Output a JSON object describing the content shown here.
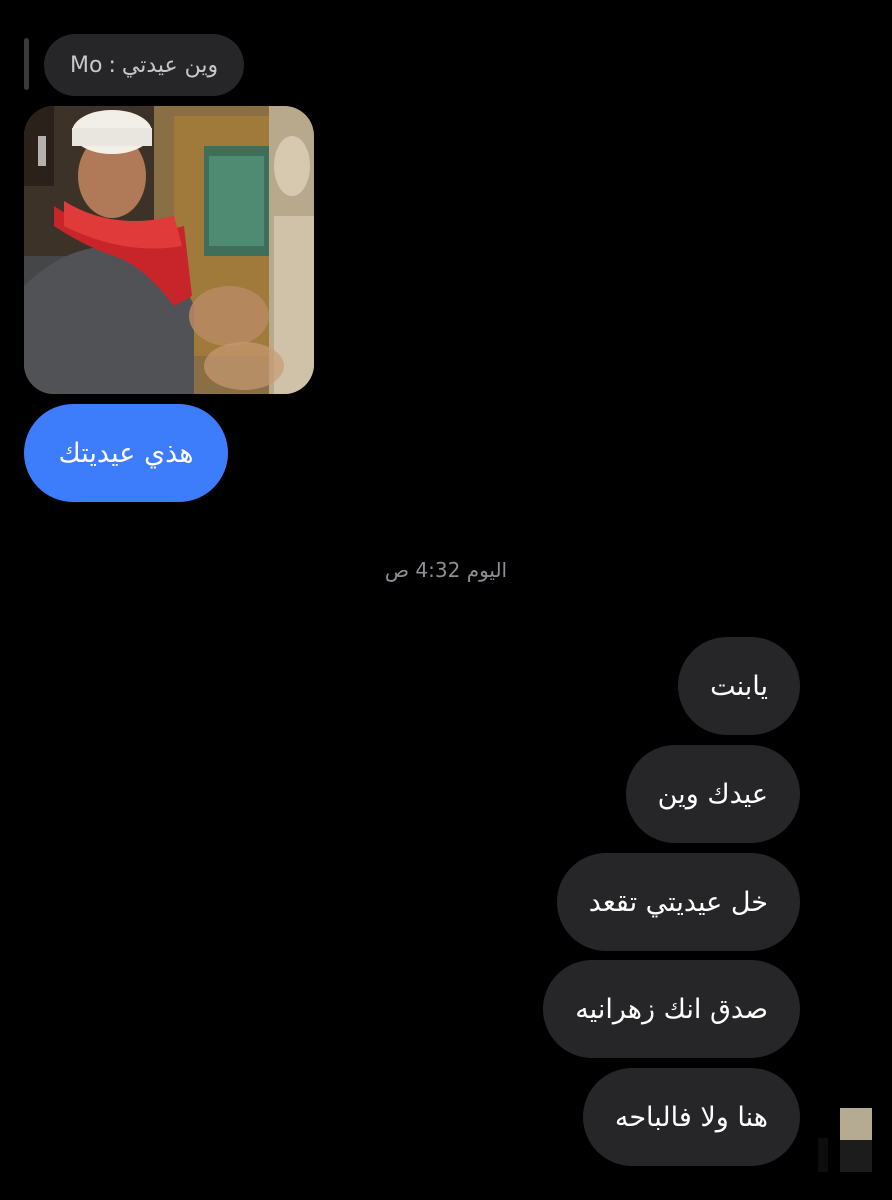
{
  "reply": {
    "sender": "Mo",
    "separator": ":",
    "text": "وين عيدتي"
  },
  "shared_image": {
    "description_icon": "photo-thumbnail"
  },
  "sent_message": "هذي عيديتك",
  "timestamp": "اليوم 4:32 ص",
  "received_messages": [
    "يابنت",
    "عيدك وين",
    "خل عيديتي تقعد",
    "صدق انك زهرانيه",
    "هنا ولا فالباحه"
  ],
  "colors": {
    "background": "#000000",
    "sent_bubble": "#3d7dfb",
    "received_bubble": "#262628",
    "timestamp": "#8e8e93"
  }
}
